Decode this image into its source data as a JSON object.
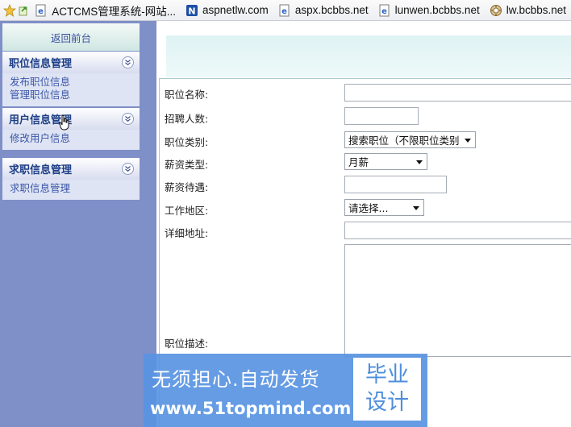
{
  "favorites_bar": {
    "items": [
      {
        "label": "ACTCMS管理系统-网站...",
        "icon": "ie-page-icon"
      },
      {
        "label": "aspnetlw.com",
        "icon": "blue-n-icon"
      },
      {
        "label": "aspx.bcbbs.net",
        "icon": "ie-page-icon"
      },
      {
        "label": "lunwen.bcbbs.net",
        "icon": "ie-page-icon"
      },
      {
        "label": "lw.bcbbs.net",
        "icon": "gear-globe-icon"
      }
    ]
  },
  "sidebar": {
    "back_link": "返回前台",
    "groups": [
      {
        "title": "职位信息管理",
        "items": [
          "发布职位信息",
          "管理职位信息"
        ]
      },
      {
        "title": "用户信息管理",
        "items": [
          "修改用户信息"
        ]
      },
      {
        "title": "求职信息管理",
        "items": [
          "求职信息管理"
        ]
      }
    ]
  },
  "form": {
    "job_name_label": "职位名称:",
    "job_name_value": "",
    "headcount_label": "招聘人数:",
    "headcount_value": "",
    "category_label": "职位类别:",
    "category_selected": "搜索职位（不限职位类别",
    "salary_type_label": "薪资类型:",
    "salary_type_selected": "月薪",
    "salary_label": "薪资待遇:",
    "salary_value": "",
    "region_label": "工作地区:",
    "region_selected": "请选择...",
    "address_label": "详细地址:",
    "address_value": "",
    "description_label": "职位描述:",
    "description_value": ""
  },
  "watermark": {
    "line1": "无须担心.自动发货",
    "url": "www.51topmind.com",
    "box_line1": "毕业",
    "box_line2": "设计"
  },
  "colors": {
    "sidebar_bg": "#7f8fc7",
    "menu_header_text": "#1d3e86",
    "menu_link": "#3a56a6",
    "watermark_bg": "#5894e2"
  }
}
